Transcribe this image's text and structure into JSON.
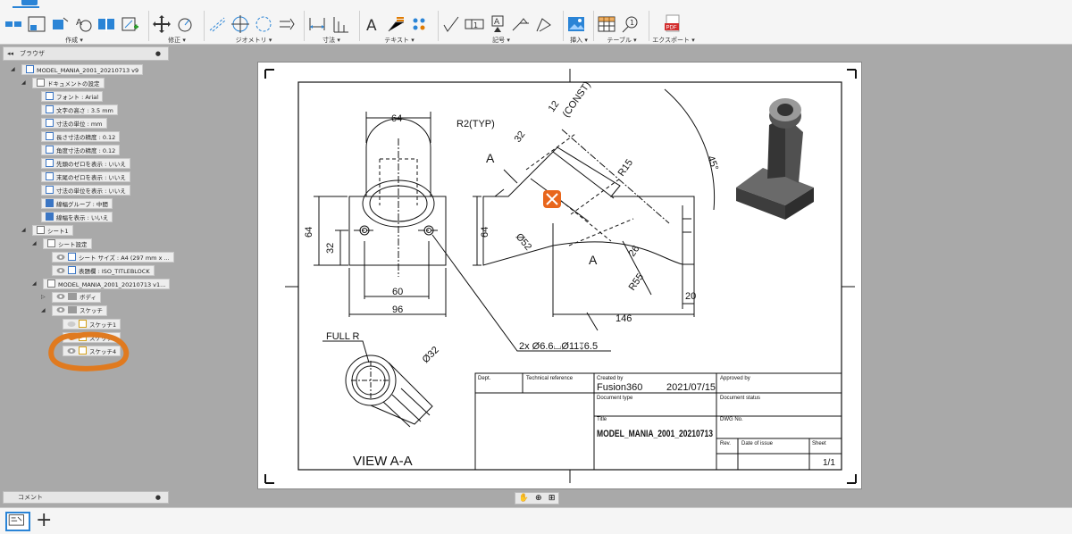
{
  "toolbar": {
    "groups": [
      {
        "label": "作成 ▾"
      },
      {
        "label": "修正 ▾"
      },
      {
        "label": "ジオメトリ ▾"
      },
      {
        "label": "寸法 ▾"
      },
      {
        "label": "テキスト ▾"
      },
      {
        "label": "記号 ▾"
      },
      {
        "label": "挿入 ▾"
      },
      {
        "label": "テーブル ▾"
      },
      {
        "label": "エクスポート ▾"
      }
    ],
    "pdf_icon_text": "PDF"
  },
  "browser": {
    "title": "ブラウザ",
    "collapse": "◂◂",
    "items": [
      {
        "label": "MODEL_MANIA_2001_20210713 v9"
      },
      {
        "label": "ドキュメントの設定"
      },
      {
        "label": "フォント : Arial"
      },
      {
        "label": "文字の高さ : 3.5 mm"
      },
      {
        "label": "寸法の単位 : mm"
      },
      {
        "label": "長さ寸法の精度 : 0.12"
      },
      {
        "label": "角度寸法の精度 : 0.12"
      },
      {
        "label": "先頭のゼロを表示 : いいえ"
      },
      {
        "label": "末尾のゼロを表示 : いいえ"
      },
      {
        "label": "寸法の単位を表示 : いいえ"
      },
      {
        "label": "線幅グループ : 中間"
      },
      {
        "label": "線幅を表示 : いいえ"
      },
      {
        "label": "シート1"
      },
      {
        "label": "シート設定"
      },
      {
        "label": "シート サイズ : A4 (297 mm x ..."
      },
      {
        "label": "表題欄 : ISO_TITLEBLOCK"
      },
      {
        "label": "MODEL_MANIA_2001_20210713 v1..."
      },
      {
        "label": "ボディ"
      },
      {
        "label": "スケッチ"
      },
      {
        "label": "スケッチ1"
      },
      {
        "label": "スケッチ2"
      },
      {
        "label": "スケッチ4"
      }
    ]
  },
  "comments": {
    "title": "コメント"
  },
  "drawing": {
    "dims": {
      "d64_top": "64",
      "d64_left": "64",
      "d32_left": "32",
      "d60": "60",
      "d96": "96",
      "r2typ": "R2(TYP)",
      "d32_rot": "32",
      "d12": "12",
      "const": "(CONST)",
      "deg45": "45°",
      "r15": "R15",
      "d52": "Ø52",
      "d64_side": "64",
      "d26": "26",
      "r55": "R55",
      "d20": "20",
      "d146": "146",
      "secA1": "A",
      "secA2": "A",
      "hole_note": "2x Ø6.6⌴Ø11↧6.5",
      "full_r": "FULL R",
      "d32_sec": "Ø32",
      "view_label": "VIEW A-A"
    },
    "title_block": {
      "dept": "Dept.",
      "tech_ref": "Technical reference",
      "created_by": "Created by",
      "creator": "Fusion360",
      "date": "2021/07/15",
      "approved_by": "Approved by",
      "doc_type": "Document type",
      "doc_status": "Document status",
      "title_lbl": "Title",
      "title_val": "MODEL_MANIA_2001_20210713",
      "dwg_no": "DWG No.",
      "rev": "Rev.",
      "date_issue": "Date of issue",
      "sheet": "Sheet",
      "sheet_val": "1/1"
    }
  }
}
